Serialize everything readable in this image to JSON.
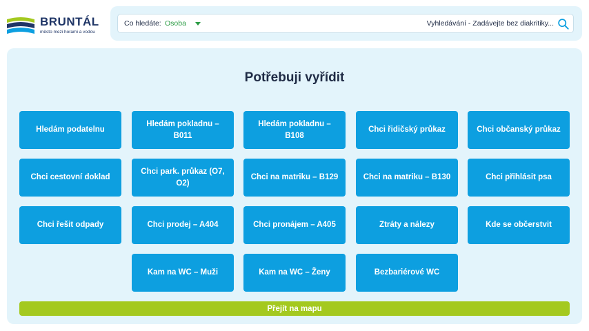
{
  "header": {
    "logo_name": "BRUNTÁL",
    "logo_tagline": "město mezi horami a vodou",
    "search": {
      "category_label": "Co hledáte:",
      "category_value": "Osoba",
      "placeholder": "Vyhledávání - Zadávejte bez diakritiky..."
    }
  },
  "main": {
    "title": "Potřebuji vyřídit",
    "tiles": [
      "Hledám podatelnu",
      "Hledám pokladnu – B011",
      "Hledám pokladnu – B108",
      "Chci řidičský průkaz",
      "Chci občanský průkaz",
      "Chci cestovní doklad",
      "Chci park. průkaz (O7, O2)",
      "Chci na matriku – B129",
      "Chci na matriku – B130",
      "Chci přihlásit psa",
      "Chci řešit odpady",
      "Chci prodej – A404",
      "Chci pronájem – A405",
      "Ztráty a nálezy",
      "Kde se občerstvit",
      "Kam na WC – Muži",
      "Kam na WC – Ženy",
      "Bezbariérové WC"
    ],
    "map_button": "Přejít na mapu"
  },
  "colors": {
    "brand_navy": "#1f3566",
    "tile_blue": "#0d9fe0",
    "map_green": "#a4c91f",
    "accent_green": "#2a9b43",
    "panel_bg": "#e3f4fb"
  },
  "icons": [
    "logo-mark-icon",
    "chevron-down-icon",
    "search-icon"
  ]
}
